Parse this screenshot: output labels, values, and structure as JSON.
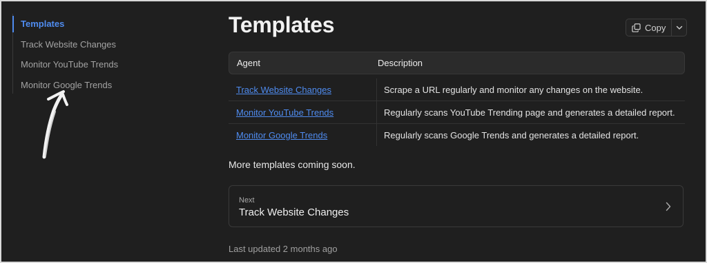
{
  "sidebar": {
    "items": [
      {
        "label": "Templates"
      },
      {
        "label": "Track Website Changes"
      },
      {
        "label": "Monitor YouTube Trends"
      },
      {
        "label": "Monitor Google Trends"
      }
    ]
  },
  "header": {
    "title": "Templates",
    "copy_label": "Copy"
  },
  "table": {
    "headers": [
      "Agent",
      "Description"
    ],
    "rows": [
      {
        "agent": "Track Website Changes",
        "description": "Scrape a URL regularly and monitor any changes on the website."
      },
      {
        "agent": "Monitor YouTube Trends",
        "description": "Regularly scans YouTube Trending page and generates a detailed report."
      },
      {
        "agent": "Monitor Google Trends",
        "description": "Regularly scans Google Trends and generates a detailed report."
      }
    ]
  },
  "main": {
    "more_text": "More templates coming soon.",
    "next": {
      "label": "Next",
      "title": "Track Website Changes"
    },
    "last_updated": "Last updated 2 months ago"
  },
  "colors": {
    "background": "#1f1f1f",
    "accent": "#4f8cf0",
    "header_row": "#2b2b2b"
  }
}
